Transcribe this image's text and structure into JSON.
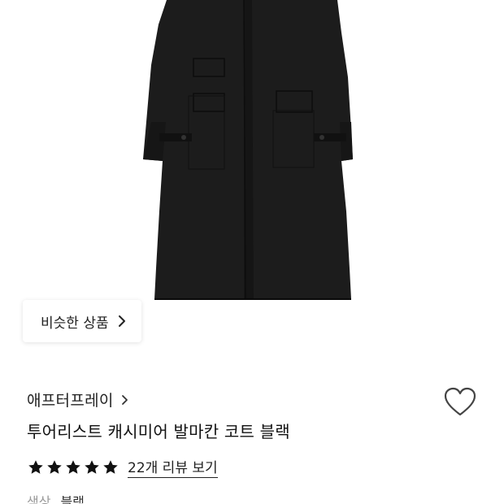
{
  "similar_button": {
    "label": "비슷한 상품",
    "icon": "chevron-right-icon"
  },
  "product": {
    "brand": "애프터프레이",
    "title": "투어리스트 캐시미어 발마칸 코트 블랙",
    "rating": 5,
    "rating_max": 5,
    "review_link": "22개 리뷰 보기",
    "color_label": "색상",
    "color_value": "블랙"
  },
  "icons": {
    "wishlist": "heart-outline-icon",
    "star": "star-icon"
  },
  "colors": {
    "coat": "#1c1c1c",
    "star": "#111111",
    "muted": "#999999"
  }
}
